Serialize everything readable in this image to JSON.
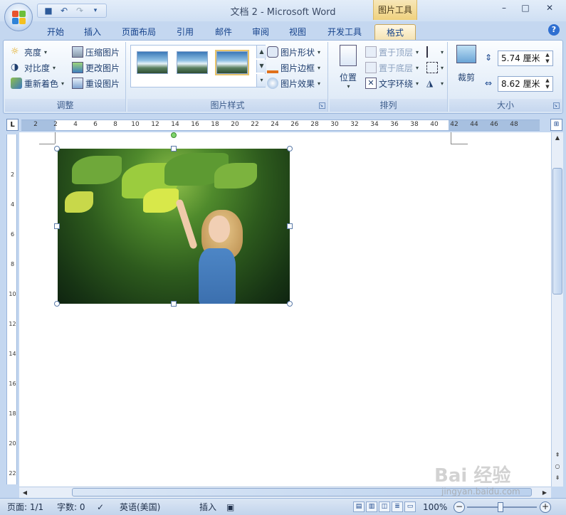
{
  "window": {
    "title": "文档 2 - Microsoft Word",
    "context_tab_title": "图片工具",
    "controls": [
      "–",
      "□",
      "✕"
    ]
  },
  "tabs": [
    "开始",
    "插入",
    "页面布局",
    "引用",
    "邮件",
    "审阅",
    "视图",
    "开发工具",
    "格式"
  ],
  "active_tab": "格式",
  "ribbon": {
    "adjust": {
      "label": "调整",
      "brightness": "亮度",
      "contrast": "对比度",
      "recolor": "重新着色",
      "compress": "压缩图片",
      "change": "更改图片",
      "reset": "重设图片"
    },
    "styles": {
      "label": "图片样式",
      "shape": "图片形状",
      "border": "图片边框",
      "effect": "图片效果"
    },
    "arrange": {
      "label": "排列",
      "position": "位置",
      "bring_front": "置于顶层",
      "send_back": "置于底层",
      "wrap": "文字环绕"
    },
    "size": {
      "label": "大小",
      "crop": "裁剪",
      "height": "5.74 厘米",
      "width": "8.62 厘米"
    }
  },
  "ruler": {
    "corner": "L",
    "h_numbers": [
      "2",
      "2",
      "4",
      "6",
      "8",
      "10",
      "12",
      "14",
      "16",
      "18",
      "20",
      "22",
      "24",
      "26",
      "28",
      "30",
      "32",
      "34",
      "36",
      "38",
      "40",
      "42",
      "44",
      "46",
      "48"
    ],
    "v_numbers": [
      "2",
      "4",
      "6",
      "8",
      "10",
      "12",
      "14",
      "16",
      "18",
      "20",
      "22"
    ]
  },
  "status": {
    "page": "页面: 1/1",
    "words": "字数: 0",
    "language": "英语(美国)",
    "mode": "插入",
    "zoom": "100%"
  },
  "watermark": {
    "brand": "Bai 经验",
    "url": "jingyan.baidu.com"
  },
  "colors": {
    "ribbon_bg": "#dbe7f6",
    "context_tab": "#efd17e",
    "accent": "#15428b"
  }
}
